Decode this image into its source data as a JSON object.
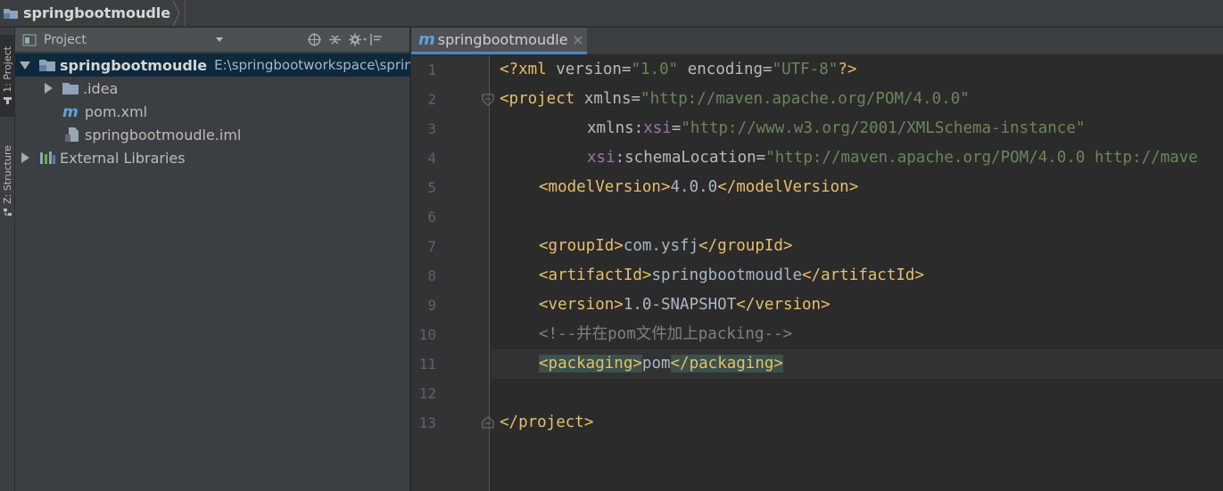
{
  "navbar": {
    "breadcrumb": "springbootmoudle"
  },
  "tool_strip": {
    "tabs": [
      {
        "label": "1: Project",
        "active": true
      },
      {
        "label": "Z: Structure",
        "active": false
      }
    ]
  },
  "project_panel": {
    "title": "Project",
    "tree": [
      {
        "label": "springbootmoudle",
        "path": "E:\\springbootworkspace\\sprin",
        "expanded": true,
        "selected": true,
        "icon": "module-folder-icon"
      },
      {
        "label": ".idea",
        "expanded": false,
        "icon": "folder-icon"
      },
      {
        "label": "pom.xml",
        "icon": "maven-icon"
      },
      {
        "label": "springbootmoudle.iml",
        "icon": "iml-file-icon"
      },
      {
        "label": "External Libraries",
        "expanded": false,
        "icon": "libraries-icon"
      }
    ]
  },
  "editor": {
    "tab_label": "springbootmoudle",
    "line_numbers": [
      "1",
      "2",
      "3",
      "4",
      "5",
      "6",
      "7",
      "8",
      "9",
      "10",
      "11",
      "12",
      "13"
    ],
    "lines": {
      "l1": {
        "p1": "<?xml ",
        "p2": "version=",
        "p3": "\"1.0\"",
        "p4": " encoding=",
        "p5": "\"UTF-8\"",
        "p6": "?>"
      },
      "l2": {
        "p1": "<project ",
        "p2": "xmlns=",
        "p3": "\"http://maven.apache.org/POM/4.0.0\""
      },
      "l3": {
        "p1": "xmlns:",
        "p2": "xsi",
        "p3": "=",
        "p4": "\"http://www.w3.org/2001/XMLSchema-instance\""
      },
      "l4": {
        "p1": "xsi",
        "p2": ":schemaLocation=",
        "p3": "\"http://maven.apache.org/POM/4.0.0 http://mave"
      },
      "l5": {
        "p1": "<modelVersion>",
        "p2": "4.0.0",
        "p3": "</modelVersion>"
      },
      "l7": {
        "p1": "<groupId>",
        "p2": "com.ysfj",
        "p3": "</groupId>"
      },
      "l8": {
        "p1": "<artifactId>",
        "p2": "springbootmoudle",
        "p3": "</artifactId>"
      },
      "l9": {
        "p1": "<version>",
        "p2": "1.0-SNAPSHOT",
        "p3": "</version>"
      },
      "l10": {
        "p1": "<!--并在pom文件加上packing-->"
      },
      "l11": {
        "p1": "<packaging>",
        "p2": "pom",
        "p3": "</packaging>"
      },
      "l13": {
        "p1": "</project>"
      }
    }
  },
  "colors": {
    "tag": "#e8bf6a",
    "string": "#6a8759",
    "namespace": "#9876aa",
    "comment": "#808080",
    "selection": "#0d293e",
    "accent": "#4a88c7"
  }
}
